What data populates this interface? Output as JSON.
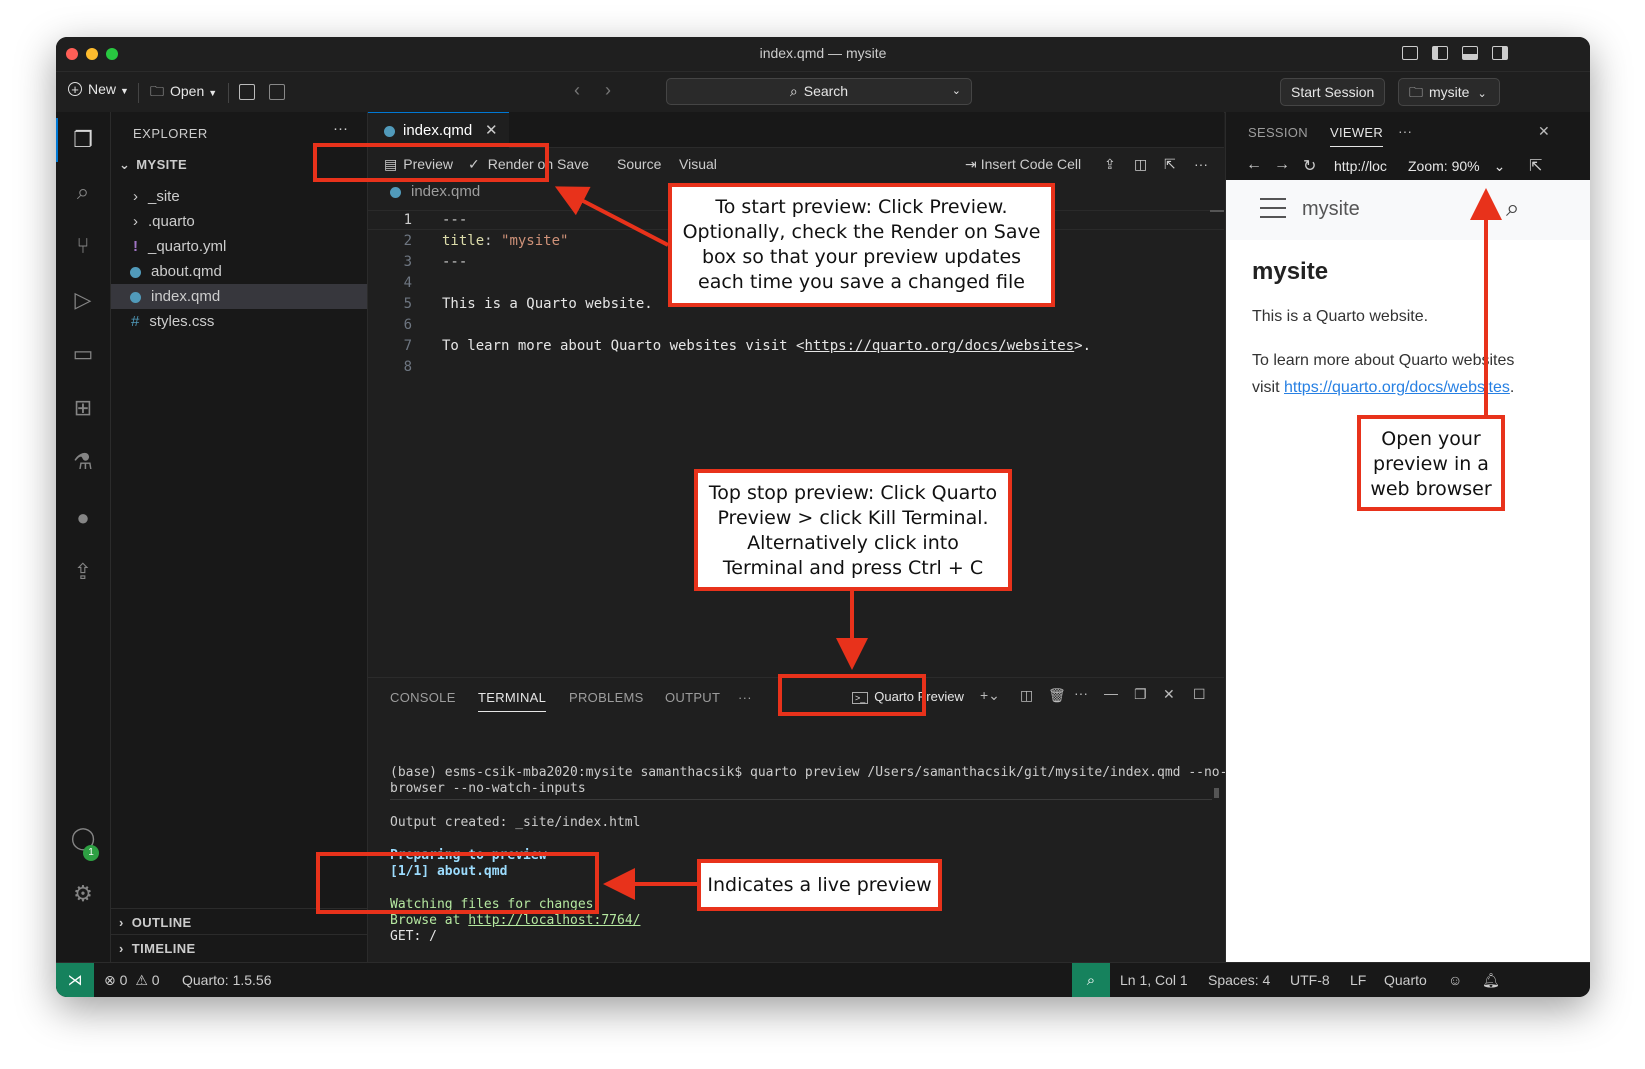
{
  "window": {
    "title": "index.qmd — mysite"
  },
  "toolbar": {
    "new_label": "New",
    "open_label": "Open",
    "search_label": "Search",
    "start_session_label": "Start Session",
    "project_label": "mysite"
  },
  "sidebar": {
    "header": "EXPLORER",
    "more": "···",
    "folder": "MYSITE",
    "items": [
      {
        "label": "_site",
        "kind": "folder"
      },
      {
        "label": ".quarto",
        "kind": "folder"
      },
      {
        "label": "_quarto.yml",
        "kind": "yaml"
      },
      {
        "label": "about.qmd",
        "kind": "qmd"
      },
      {
        "label": "index.qmd",
        "kind": "qmd",
        "selected": true
      },
      {
        "label": "styles.css",
        "kind": "css"
      }
    ],
    "outline_label": "OUTLINE",
    "timeline_label": "TIMELINE",
    "account_badge": "1"
  },
  "editor": {
    "tab_label": "index.qmd",
    "toolbar": {
      "preview": "Preview",
      "render_on_save": "Render on Save",
      "source": "Source",
      "visual": "Visual",
      "insert_code_cell": "Insert Code Cell",
      "more": "···"
    },
    "breadcrumb": "index.qmd",
    "lines": [
      {
        "n": "1",
        "text": "---"
      },
      {
        "n": "2",
        "key": "title",
        "value": "\"mysite\""
      },
      {
        "n": "3",
        "text": "---"
      },
      {
        "n": "4",
        "text": ""
      },
      {
        "n": "5",
        "text": "This is a Quarto website."
      },
      {
        "n": "6",
        "text": ""
      },
      {
        "n": "7",
        "prefix": "To learn more about Quarto websites visit <",
        "link": "https://quarto.org/docs/websites",
        "suffix": ">."
      },
      {
        "n": "8",
        "text": ""
      }
    ]
  },
  "panel": {
    "tabs": [
      "CONSOLE",
      "TERMINAL",
      "PROBLEMS",
      "OUTPUT"
    ],
    "more": "···",
    "active_tab": "TERMINAL",
    "terminal_name": "Quarto Preview",
    "terminal": {
      "cmd1": "(base) esms-csik-mba2020:mysite samanthacsik$ quarto preview /Users/samanthacsik/git/mysite/index.qmd --no-",
      "cmd2": "browser --no-watch-inputs",
      "output": "Output created: _site/index.html",
      "preparing": "Preparing to preview",
      "progress": "[1/1] about.qmd",
      "watching": "Watching files for changes",
      "browse_prefix": "Browse at ",
      "browse_url": "http://localhost:7764/",
      "get": "GET: /"
    }
  },
  "viewer": {
    "tabs": [
      "SESSION",
      "VIEWER"
    ],
    "more": "···",
    "url": "http://loc",
    "zoom": "Zoom: 90%",
    "site_name": "mysite",
    "heading": "mysite",
    "para1": "This is a Quarto website.",
    "para2_a": "To learn more about Quarto websites",
    "para2_b": "visit ",
    "link": "https://quarto.org/docs/websites",
    "link_suffix": "."
  },
  "statusbar": {
    "errors": "0",
    "warnings": "0",
    "quarto_version": "Quarto: 1.5.56",
    "position": "Ln 1, Col 1",
    "spaces": "Spaces: 4",
    "encoding": "UTF-8",
    "eol": "LF",
    "language": "Quarto"
  },
  "annotations": {
    "start_preview": [
      "To start preview: Click Preview.",
      "Optionally, check the Render on Save",
      "box so that your preview updates",
      "each time you save a changed file"
    ],
    "stop_preview": [
      "Top stop preview: Click Quarto",
      "Preview > click Kill Terminal.",
      "Alternatively click into",
      "Terminal and press Ctrl + C"
    ],
    "open_browser": [
      "Open your",
      "preview in a",
      "web browser"
    ],
    "live_preview": "Indicates a live preview"
  },
  "colors": {
    "annotation_red": "#e8321b",
    "accent_blue": "#0078d4",
    "status_green": "#16825d"
  }
}
